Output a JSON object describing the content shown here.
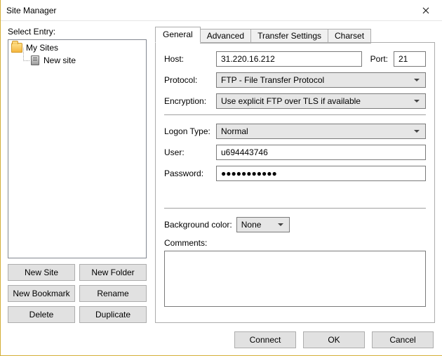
{
  "window": {
    "title": "Site Manager"
  },
  "left": {
    "select_label": "Select Entry:",
    "tree": {
      "root_label": "My Sites",
      "entry_label": "New site"
    },
    "buttons": {
      "new_site": "New Site",
      "new_folder": "New Folder",
      "new_bookmark": "New Bookmark",
      "rename": "Rename",
      "delete": "Delete",
      "duplicate": "Duplicate"
    }
  },
  "tabs": {
    "general": "General",
    "advanced": "Advanced",
    "transfer": "Transfer Settings",
    "charset": "Charset"
  },
  "form": {
    "host_label": "Host:",
    "host_value": "31.220.16.212",
    "port_label": "Port:",
    "port_value": "21",
    "protocol_label": "Protocol:",
    "protocol_value": "FTP - File Transfer Protocol",
    "encryption_label": "Encryption:",
    "encryption_value": "Use explicit FTP over TLS if available",
    "logon_type_label": "Logon Type:",
    "logon_type_value": "Normal",
    "user_label": "User:",
    "user_value": "u694443746",
    "password_label": "Password:",
    "password_value": "●●●●●●●●●●●",
    "bgcolor_label": "Background color:",
    "bgcolor_value": "None",
    "comments_label": "Comments:",
    "comments_value": ""
  },
  "footer": {
    "connect": "Connect",
    "ok": "OK",
    "cancel": "Cancel"
  }
}
